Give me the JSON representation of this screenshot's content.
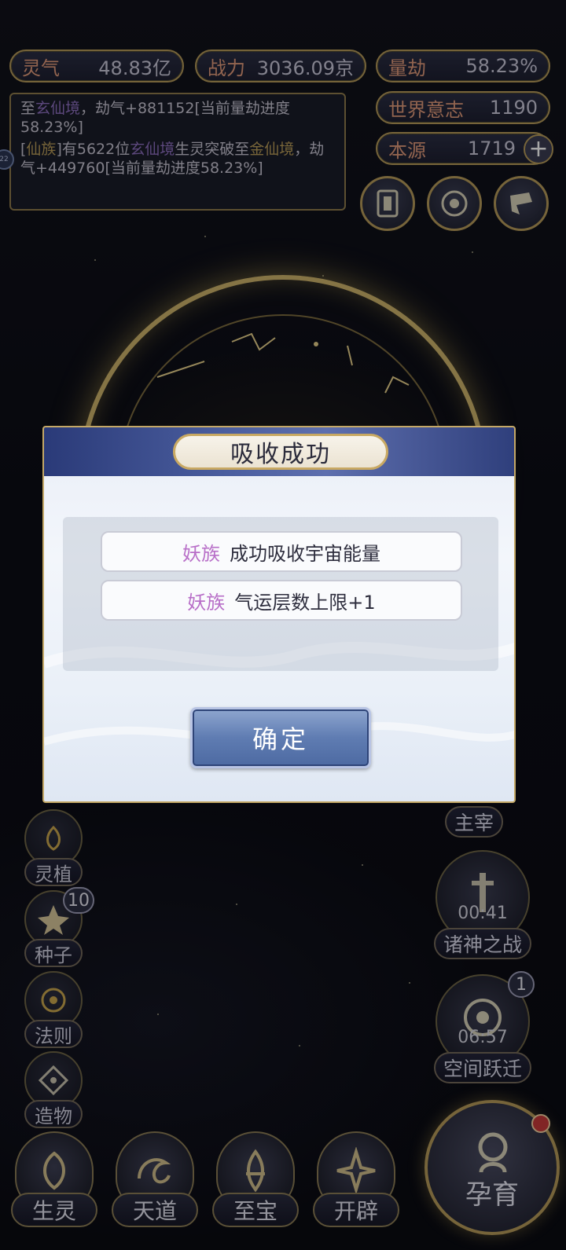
{
  "resources": {
    "lingqi": {
      "label": "灵气",
      "value": "48.83亿"
    },
    "zhanli": {
      "label": "战力",
      "value": "3036.09京"
    },
    "liangjie": {
      "label": "量劫",
      "value": "58.23%"
    },
    "shijie": {
      "label": "世界意志",
      "value": "1190"
    },
    "benyuan": {
      "label": "本源",
      "value": "1719",
      "plus": "+"
    }
  },
  "log": {
    "line1_prefix": "至",
    "line1_realm": "玄仙境",
    "line1_suffix": "，劫气+881152[当前量劫进度58.23%]",
    "line2_open": "[",
    "line2_race": "仙族",
    "line2_mid": "]有5622位",
    "line2_realm": "玄仙境",
    "line2_mid2": "生灵突破至",
    "line2_target": "金仙境",
    "line2_suffix": "，劫气+449760[当前量劫进度58.23%]",
    "side_badge": "22"
  },
  "left_menu": [
    {
      "label": "灵植",
      "icon": "spirit-plant-icon"
    },
    {
      "label": "种子",
      "icon": "seed-icon",
      "badge": "10"
    },
    {
      "label": "法则",
      "icon": "law-icon"
    },
    {
      "label": "造物",
      "icon": "creation-icon"
    }
  ],
  "right_menu": {
    "zhuzai": {
      "label": "主宰"
    },
    "zhushen": {
      "label": "诸神之战",
      "timer": "00:41"
    },
    "kongjian": {
      "label": "空间跃迁",
      "timer": "06:57",
      "badge": "1"
    }
  },
  "bottom_nav": [
    {
      "label": "生灵",
      "icon": "creature-icon"
    },
    {
      "label": "天道",
      "icon": "heaven-icon"
    },
    {
      "label": "至宝",
      "icon": "treasure-icon"
    },
    {
      "label": "开辟",
      "icon": "develop-icon"
    }
  ],
  "main_action": {
    "label": "孕育"
  },
  "dialog": {
    "title": "吸收成功",
    "rows": [
      {
        "race": "妖族",
        "text": "成功吸收宇宙能量"
      },
      {
        "race": "妖族",
        "text": "气运层数上限+1"
      }
    ],
    "confirm": "确定"
  },
  "colors": {
    "gold": "#b59a5a",
    "race_highlight": "#b86fc8",
    "dialog_header": "#4c5fa0"
  }
}
